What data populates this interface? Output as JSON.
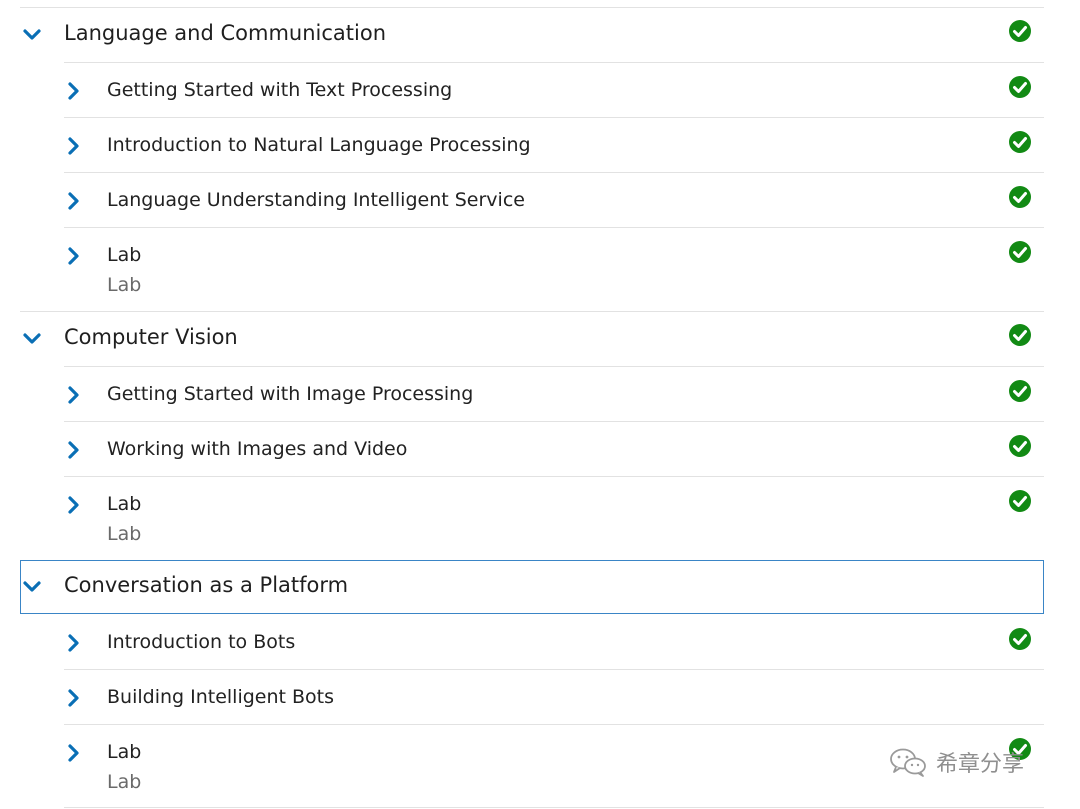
{
  "colors": {
    "chevron": "#0a6fb5",
    "check_fill": "#128a14",
    "focus_border": "#3a85c6",
    "divider": "#e2e2e2"
  },
  "icons": {
    "expanded": "chevron-down-icon",
    "collapsed": "chevron-right-icon",
    "completed": "check-circle-icon",
    "watermark": "wechat-icon"
  },
  "modules": [
    {
      "title": "Language and Communication",
      "completed": true,
      "expanded": true,
      "units": [
        {
          "title": "Getting Started with Text Processing",
          "completed": true
        },
        {
          "title": "Introduction to Natural Language Processing",
          "completed": true
        },
        {
          "title": "Language Understanding Intelligent Service",
          "completed": true
        },
        {
          "title": "Lab",
          "subtitle": "Lab",
          "completed": true
        }
      ]
    },
    {
      "title": "Computer Vision",
      "completed": true,
      "expanded": true,
      "units": [
        {
          "title": "Getting Started with Image Processing",
          "completed": true
        },
        {
          "title": "Working with Images and Video",
          "completed": true
        },
        {
          "title": "Lab",
          "subtitle": "Lab",
          "completed": true
        }
      ]
    },
    {
      "title": "Conversation as a Platform",
      "completed": false,
      "expanded": true,
      "focused": true,
      "units": [
        {
          "title": "Introduction to Bots",
          "completed": true
        },
        {
          "title": "Building Intelligent Bots",
          "completed": false
        },
        {
          "title": "Lab",
          "subtitle": "Lab",
          "completed": true
        }
      ]
    }
  ],
  "watermark": {
    "text": "希章分享"
  }
}
